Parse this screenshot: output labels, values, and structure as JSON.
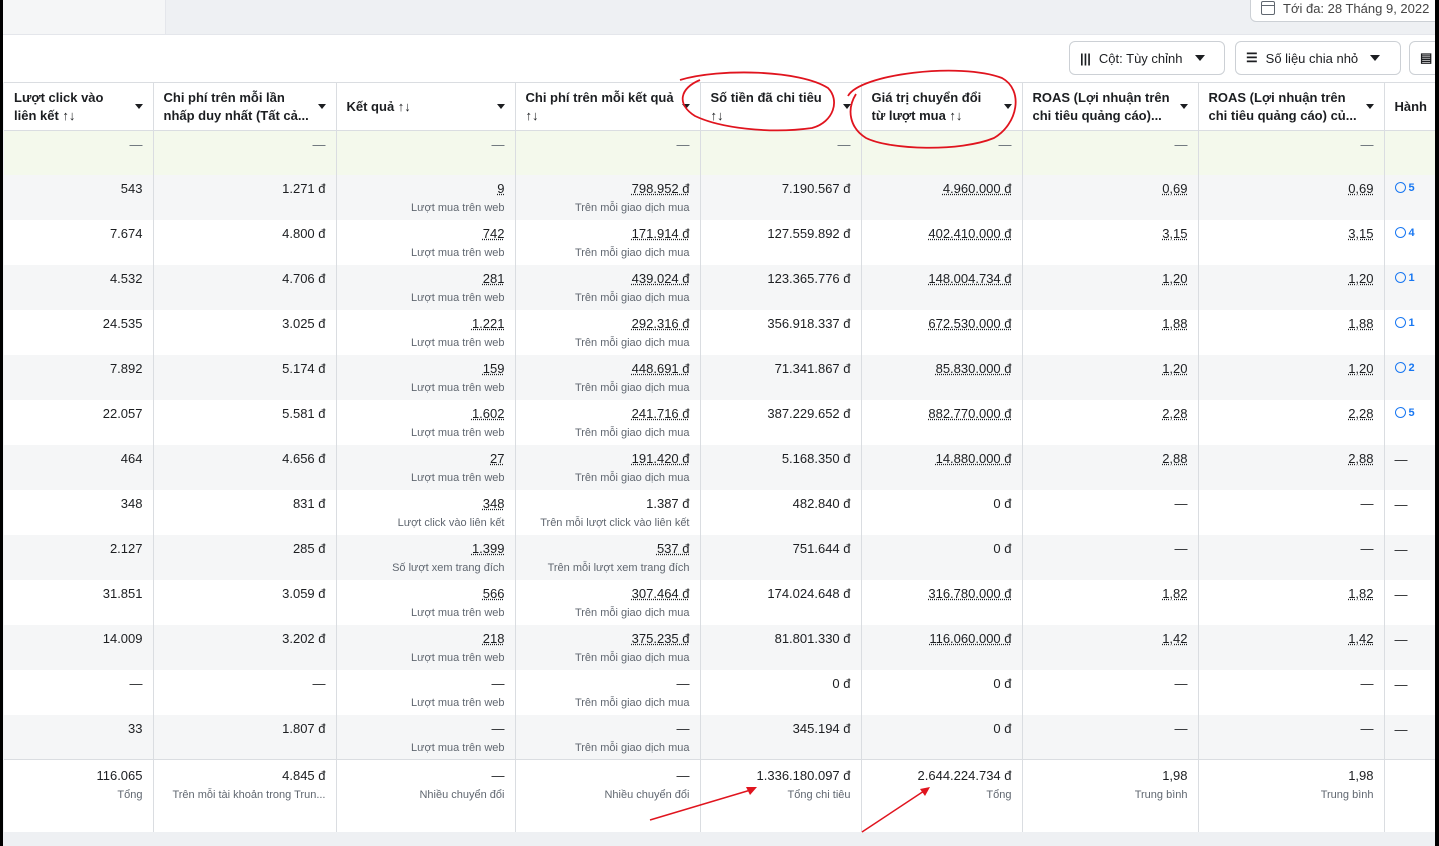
{
  "date_range": "Tới đa: 28 Tháng 9, 2022",
  "toolbar": {
    "columns_label": "Cột: Tùy chỉnh",
    "breakdown_label": "Số liệu chia nhỏ"
  },
  "columns": [
    {
      "label": "Lượt click vào liên kết ↑↓"
    },
    {
      "label": "Chi phí trên mỗi lần nhấp duy nhất (Tất cả..."
    },
    {
      "label": "Kết quả ↑↓"
    },
    {
      "label": "Chi phí trên mỗi kết quả ↑↓"
    },
    {
      "label": "Số tiền đã chi tiêu ↑↓"
    },
    {
      "label": "Giá trị chuyển đổi từ lượt mua ↑↓"
    },
    {
      "label": "ROAS (Lợi nhuận trên chi tiêu quảng cáo)..."
    },
    {
      "label": "ROAS (Lợi nhuận trên chi tiêu quảng cáo) củ..."
    },
    {
      "label": "Hành"
    }
  ],
  "blank_row": [
    "—",
    "—",
    "—",
    "—",
    "—",
    "—",
    "—",
    "—",
    ""
  ],
  "rows": [
    {
      "clicks": "543",
      "cpc": "1.271 đ",
      "result": "9",
      "result_sub": "Lượt mua trên web",
      "cpr": "798.952 đ",
      "cpr_sub": "Trên mỗi giao dịch mua",
      "spent": "7.190.567 đ",
      "conv": "4.960.000 đ",
      "roas1": "0,69",
      "roas2": "0,69",
      "act": "5"
    },
    {
      "clicks": "7.674",
      "cpc": "4.800 đ",
      "result": "742",
      "result_sub": "Lượt mua trên web",
      "cpr": "171.914 đ",
      "cpr_sub": "Trên mỗi giao dịch mua",
      "spent": "127.559.892 đ",
      "conv": "402.410.000 đ",
      "roas1": "3,15",
      "roas2": "3,15",
      "act": "4"
    },
    {
      "clicks": "4.532",
      "cpc": "4.706 đ",
      "result": "281",
      "result_sub": "Lượt mua trên web",
      "cpr": "439.024 đ",
      "cpr_sub": "Trên mỗi giao dịch mua",
      "spent": "123.365.776 đ",
      "conv": "148.004.734 đ",
      "roas1": "1,20",
      "roas2": "1,20",
      "act": "1"
    },
    {
      "clicks": "24.535",
      "cpc": "3.025 đ",
      "result": "1.221",
      "result_sub": "Lượt mua trên web",
      "cpr": "292.316 đ",
      "cpr_sub": "Trên mỗi giao dịch mua",
      "spent": "356.918.337 đ",
      "conv": "672.530.000 đ",
      "roas1": "1,88",
      "roas2": "1,88",
      "act": "1"
    },
    {
      "clicks": "7.892",
      "cpc": "5.174 đ",
      "result": "159",
      "result_sub": "Lượt mua trên web",
      "cpr": "448.691 đ",
      "cpr_sub": "Trên mỗi giao dịch mua",
      "spent": "71.341.867 đ",
      "conv": "85.830.000 đ",
      "roas1": "1,20",
      "roas2": "1,20",
      "act": "2"
    },
    {
      "clicks": "22.057",
      "cpc": "5.581 đ",
      "result": "1.602",
      "result_sub": "Lượt mua trên web",
      "cpr": "241.716 đ",
      "cpr_sub": "Trên mỗi giao dịch mua",
      "spent": "387.229.652 đ",
      "conv": "882.770.000 đ",
      "roas1": "2,28",
      "roas2": "2,28",
      "act": "5"
    },
    {
      "clicks": "464",
      "cpc": "4.656 đ",
      "result": "27",
      "result_sub": "Lượt mua trên web",
      "cpr": "191.420 đ",
      "cpr_sub": "Trên mỗi giao dịch mua",
      "spent": "5.168.350 đ",
      "conv": "14.880.000 đ",
      "roas1": "2,88",
      "roas2": "2,88",
      "act": "—"
    },
    {
      "clicks": "348",
      "cpc": "831 đ",
      "result": "348",
      "result_sub": "Lượt click vào liên kết",
      "cpr": "1.387 đ",
      "cpr_sub": "Trên mỗi lượt click vào liên kết",
      "spent": "482.840 đ",
      "conv": "0 đ",
      "roas1": "—",
      "roas2": "—",
      "act": "—"
    },
    {
      "clicks": "2.127",
      "cpc": "285 đ",
      "result": "1.399",
      "result_sub": "Số lượt xem trang đích",
      "cpr": "537 đ",
      "cpr_sub": "Trên mỗi lượt xem trang đích",
      "spent": "751.644 đ",
      "conv": "0 đ",
      "roas1": "—",
      "roas2": "—",
      "act": "—"
    },
    {
      "clicks": "31.851",
      "cpc": "3.059 đ",
      "result": "566",
      "result_sub": "Lượt mua trên web",
      "cpr": "307.464 đ",
      "cpr_sub": "Trên mỗi giao dịch mua",
      "spent": "174.024.648 đ",
      "conv": "316.780.000 đ",
      "roas1": "1,82",
      "roas2": "1,82",
      "act": "—"
    },
    {
      "clicks": "14.009",
      "cpc": "3.202 đ",
      "result": "218",
      "result_sub": "Lượt mua trên web",
      "cpr": "375.235 đ",
      "cpr_sub": "Trên mỗi giao dịch mua",
      "spent": "81.801.330 đ",
      "conv": "116.060.000 đ",
      "roas1": "1,42",
      "roas2": "1,42",
      "act": "—"
    },
    {
      "clicks": "—",
      "cpc": "—",
      "result": "—",
      "result_sub": "Lượt mua trên web",
      "cpr": "—",
      "cpr_sub": "Trên mỗi giao dịch mua",
      "spent": "0 đ",
      "conv": "0 đ",
      "roas1": "—",
      "roas2": "—",
      "act": "—"
    },
    {
      "clicks": "33",
      "cpc": "1.807 đ",
      "result": "—",
      "result_sub": "Lượt mua trên web",
      "cpr": "—",
      "cpr_sub": "Trên mỗi giao dịch mua",
      "spent": "345.194 đ",
      "conv": "0 đ",
      "roas1": "—",
      "roas2": "—",
      "act": "—"
    }
  ],
  "totals": {
    "clicks": "116.065",
    "clicks_sub": "Tổng",
    "cpc": "4.845 đ",
    "cpc_sub": "Trên mỗi tài khoản trong Trun...",
    "result": "—",
    "result_sub": "Nhiều chuyển đổi",
    "cpr": "—",
    "cpr_sub": "Nhiều chuyển đổi",
    "spent": "1.336.180.097 đ",
    "spent_sub": "Tổng chi tiêu",
    "conv": "2.644.224.734 đ",
    "conv_sub": "Tổng",
    "roas1": "1,98",
    "roas1_sub": "Trung bình",
    "roas2": "1,98",
    "roas2_sub": "Trung bình"
  },
  "colors": {
    "annotation": "#e0141e",
    "link": "#1877f2"
  }
}
